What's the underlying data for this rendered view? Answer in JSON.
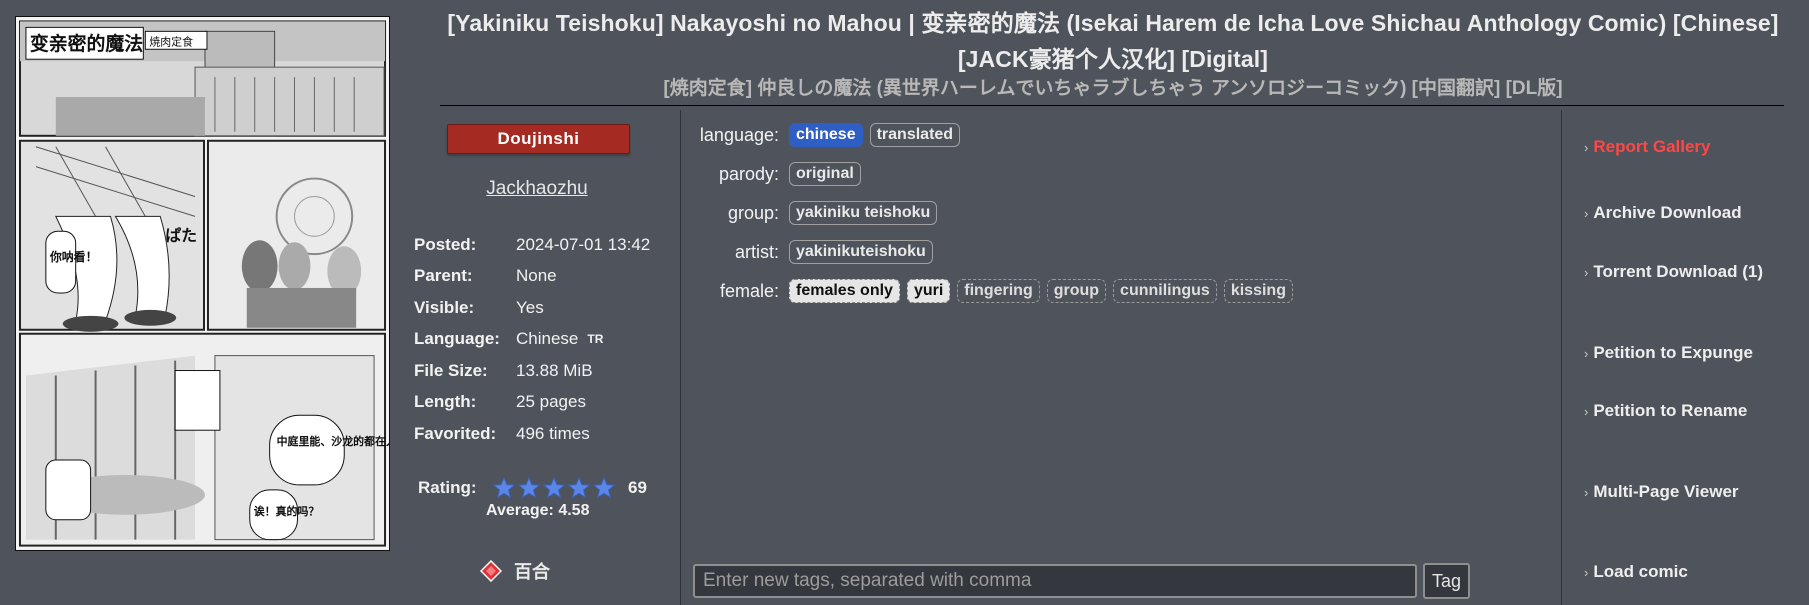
{
  "gallery": {
    "title_en": "[Yakiniku Teishoku] Nakayoshi no Mahou | 变亲密的魔法 (Isekai Harem de Icha Love Shichau Anthology Comic) [Chinese] [JACK豪猪个人汉化] [Digital]",
    "title_jp": "[焼肉定食] 仲良しの魔法 (異世界ハーレムでいちゃラブしちゃう アンソロジーコミック) [中国翻訳] [DL版]",
    "category": "Doujinshi",
    "uploader": "Jackhaozhu"
  },
  "cover": {
    "title_text": "变亲密的魔法",
    "author_stamp": "焼肉定食",
    "sfx_right": "ぱた",
    "speech": [
      "你呐看！",
      "中庭里能、沙龙的都在人啊",
      "诶！真的吗？"
    ]
  },
  "info": [
    {
      "key": "Posted:",
      "value": "2024-07-01 13:42"
    },
    {
      "key": "Parent:",
      "value": "None"
    },
    {
      "key": "Visible:",
      "value": "Yes"
    },
    {
      "key": "Language:",
      "value": "Chinese",
      "badge": "TR"
    },
    {
      "key": "File Size:",
      "value": "13.88 MiB"
    },
    {
      "key": "Length:",
      "value": "25 pages"
    },
    {
      "key": "Favorited:",
      "value": "496 times"
    }
  ],
  "rating": {
    "label": "Rating:",
    "count": "69",
    "average": "Average: 4.58",
    "stars": 5,
    "star_color": "#5a86e8"
  },
  "favorite": {
    "label": "百合",
    "icon": "diamond-icon",
    "color": "#e0303a"
  },
  "tags": [
    {
      "namespace": "language:",
      "items": [
        {
          "name": "chinese",
          "style": "highlight"
        },
        {
          "name": "translated",
          "style": "solid"
        }
      ]
    },
    {
      "namespace": "parody:",
      "items": [
        {
          "name": "original",
          "style": "solid"
        }
      ]
    },
    {
      "namespace": "group:",
      "items": [
        {
          "name": "yakiniku teishoku",
          "style": "solid"
        }
      ]
    },
    {
      "namespace": "artist:",
      "items": [
        {
          "name": "yakinikuteishoku",
          "style": "solid"
        }
      ]
    },
    {
      "namespace": "female:",
      "items": [
        {
          "name": "females only",
          "style": "light"
        },
        {
          "name": "yuri",
          "style": "light"
        },
        {
          "name": "fingering",
          "style": "dashed"
        },
        {
          "name": "group",
          "style": "dashed"
        },
        {
          "name": "cunnilingus",
          "style": "dashed"
        },
        {
          "name": "kissing",
          "style": "dashed"
        }
      ]
    }
  ],
  "tag_input": {
    "placeholder": "Enter new tags, separated with comma",
    "button_label": "Tag"
  },
  "actions": [
    {
      "label": "Report Gallery",
      "variant": "report"
    },
    {
      "label": "Archive Download",
      "variant": "normal"
    },
    {
      "label": "Torrent Download (1)",
      "variant": "normal"
    },
    {
      "label": "Petition to Expunge",
      "variant": "normal"
    },
    {
      "label": "Petition to Rename",
      "variant": "normal"
    },
    {
      "label": "Multi-Page Viewer",
      "variant": "normal"
    },
    {
      "label": "Load comic",
      "variant": "normal"
    }
  ],
  "colors": {
    "background": "#4f535b",
    "category_bg": "#a52a22",
    "report_link": "#ff4747",
    "highlight_tag": "#2f5fc4"
  }
}
